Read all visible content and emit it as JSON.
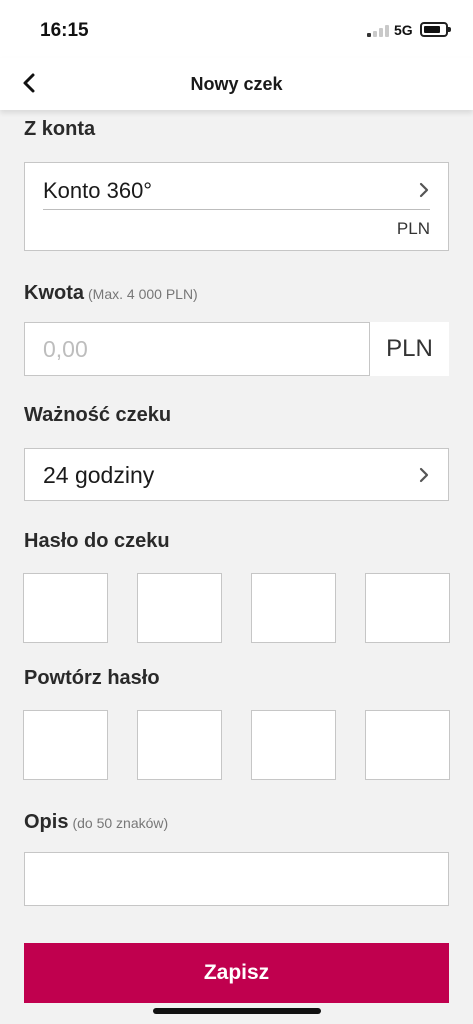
{
  "status_bar": {
    "time": "16:15",
    "network": "5G"
  },
  "nav": {
    "title": "Nowy czek"
  },
  "from_account": {
    "label": "Z konta",
    "account_name": "Konto 360°",
    "currency": "PLN"
  },
  "amount": {
    "label": "Kwota",
    "hint": "(Max. 4 000 PLN)",
    "placeholder": "0,00",
    "currency": "PLN"
  },
  "validity": {
    "label": "Ważność czeku",
    "value": "24 godziny"
  },
  "password": {
    "label": "Hasło do czeku"
  },
  "repeat_password": {
    "label": "Powtórz hasło"
  },
  "description": {
    "label": "Opis",
    "hint": "(do 50 znaków)"
  },
  "actions": {
    "save_label": "Zapisz"
  },
  "colors": {
    "accent": "#c0004e",
    "background": "#f2f2f2"
  }
}
